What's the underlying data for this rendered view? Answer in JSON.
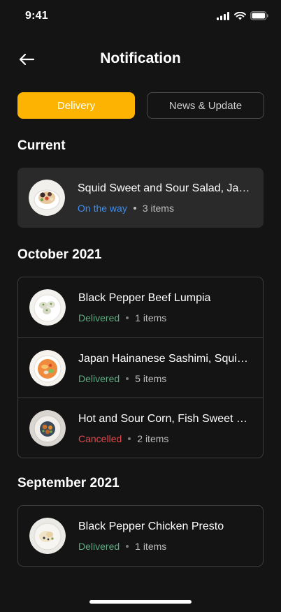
{
  "status_bar": {
    "time": "9:41"
  },
  "header": {
    "title": "Notification"
  },
  "tabs": [
    {
      "label": "Delivery"
    },
    {
      "label": "News & Update"
    }
  ],
  "colors": {
    "accent": "#fcb301",
    "on_the_way": "#3c8df0",
    "delivered": "#5faa82",
    "cancelled": "#e5484d"
  },
  "sections": {
    "current": {
      "heading": "Current",
      "items": [
        {
          "title": "Squid Sweet and Sour Salad, Japanese Style",
          "status": "On the way",
          "count": "3 items"
        }
      ]
    },
    "october": {
      "heading": "October 2021",
      "items": [
        {
          "title": "Black Pepper Beef Lumpia",
          "status": "Delivered",
          "count": "1 items"
        },
        {
          "title": "Japan Hainanese Sashimi, Squid Salad",
          "status": "Delivered",
          "count": "5 items"
        },
        {
          "title": "Hot and Sour Corn, Fish Sweet and Sour",
          "status": "Cancelled",
          "count": "2 items"
        }
      ]
    },
    "september": {
      "heading": "September 2021",
      "items": [
        {
          "title": "Black Pepper Chicken Presto",
          "status": "Delivered",
          "count": "1 items"
        }
      ]
    }
  }
}
